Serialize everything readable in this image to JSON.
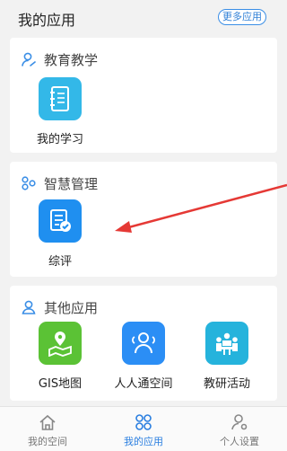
{
  "header": {
    "title": "我的应用",
    "more_label": "更多应用"
  },
  "sections": [
    {
      "title": "教育教学",
      "icon": "user-icon",
      "apps": [
        {
          "label": "我的学习",
          "icon": "notebook-icon",
          "color": "#33b8e8"
        }
      ]
    },
    {
      "title": "智慧管理",
      "icon": "modules-icon",
      "apps": [
        {
          "label": "综评",
          "icon": "document-check-icon",
          "color": "#1f8ff0"
        }
      ]
    },
    {
      "title": "其他应用",
      "icon": "person-icon",
      "apps": [
        {
          "label": "GIS地图",
          "icon": "map-pin-icon",
          "color": "#5bc235"
        },
        {
          "label": "人人通空间",
          "icon": "people-icon",
          "color": "#2b8ef5"
        },
        {
          "label": "教研活动",
          "icon": "meeting-icon",
          "color": "#25b3dc"
        }
      ]
    }
  ],
  "tabbar": [
    {
      "label": "我的空间",
      "icon": "home-icon",
      "active": false
    },
    {
      "label": "我的应用",
      "icon": "apps-icon",
      "active": true
    },
    {
      "label": "个人设置",
      "icon": "user-settings-icon",
      "active": false
    }
  ],
  "colors": {
    "accent": "#2b7fe0",
    "annotation_arrow": "#e53935"
  }
}
